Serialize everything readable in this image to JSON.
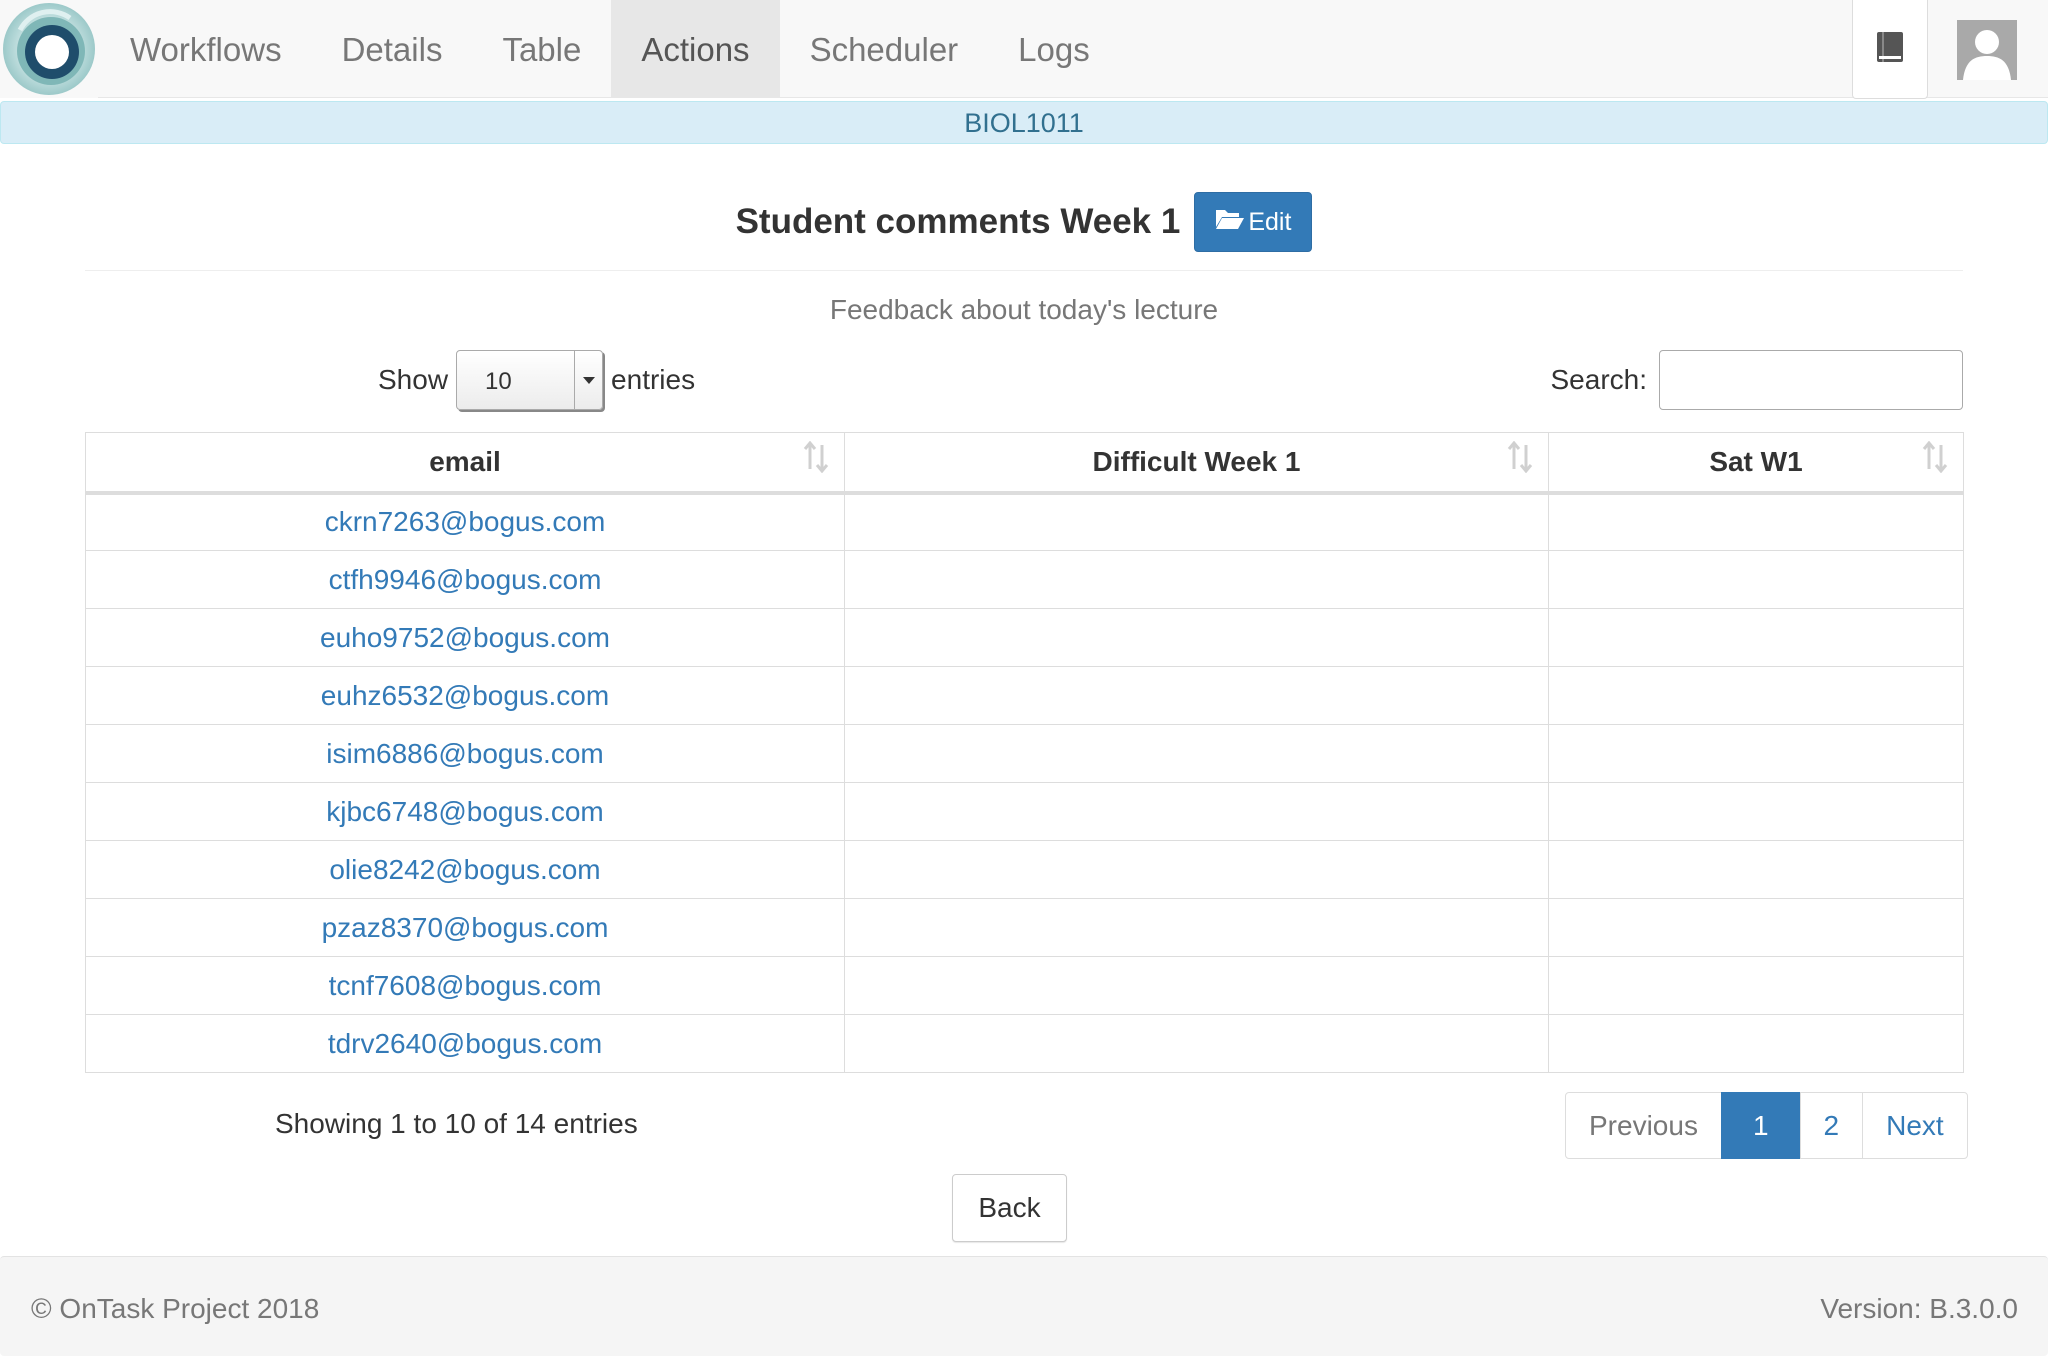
{
  "nav": {
    "items": [
      {
        "label": "Workflows",
        "active": false
      },
      {
        "label": "Details",
        "active": false
      },
      {
        "label": "Table",
        "active": false
      },
      {
        "label": "Actions",
        "active": true
      },
      {
        "label": "Scheduler",
        "active": false
      },
      {
        "label": "Logs",
        "active": false
      }
    ],
    "logo_icon": "ontask-logo-icon",
    "docs_icon": "book-icon",
    "avatar_icon": "user-avatar-icon"
  },
  "workflow": {
    "name": "BIOL1011"
  },
  "action": {
    "title": "Student comments Week 1",
    "edit_label": "Edit",
    "edit_icon": "folder-open-icon",
    "description": "Feedback about today's lecture"
  },
  "table_controls": {
    "show_label": "Show",
    "entries_label": "entries",
    "page_length": "10",
    "search_label": "Search:",
    "search_value": ""
  },
  "table": {
    "columns": [
      "email",
      "Difficult Week 1",
      "Sat W1"
    ],
    "rows": [
      {
        "email": "ckrn7263@bogus.com",
        "difficult": "",
        "sat": ""
      },
      {
        "email": "ctfh9946@bogus.com",
        "difficult": "",
        "sat": ""
      },
      {
        "email": "euho9752@bogus.com",
        "difficult": "",
        "sat": ""
      },
      {
        "email": "euhz6532@bogus.com",
        "difficult": "",
        "sat": ""
      },
      {
        "email": "isim6886@bogus.com",
        "difficult": "",
        "sat": ""
      },
      {
        "email": "kjbc6748@bogus.com",
        "difficult": "",
        "sat": ""
      },
      {
        "email": "olie8242@bogus.com",
        "difficult": "",
        "sat": ""
      },
      {
        "email": "pzaz8370@bogus.com",
        "difficult": "",
        "sat": ""
      },
      {
        "email": "tcnf7608@bogus.com",
        "difficult": "",
        "sat": ""
      },
      {
        "email": "tdrv2640@bogus.com",
        "difficult": "",
        "sat": ""
      }
    ]
  },
  "pagination": {
    "info": "Showing 1 to 10 of 14 entries",
    "previous_label": "Previous",
    "pages": [
      "1",
      "2"
    ],
    "current_page": "1",
    "next_label": "Next"
  },
  "back_label": "Back",
  "footer": {
    "copyright": "© OnTask Project 2018",
    "version": "Version: B.3.0.0"
  },
  "colors": {
    "primary": "#337ab7",
    "banner_bg": "#d9edf7",
    "banner_text": "#31708f",
    "navbar_bg": "#f8f8f8"
  }
}
